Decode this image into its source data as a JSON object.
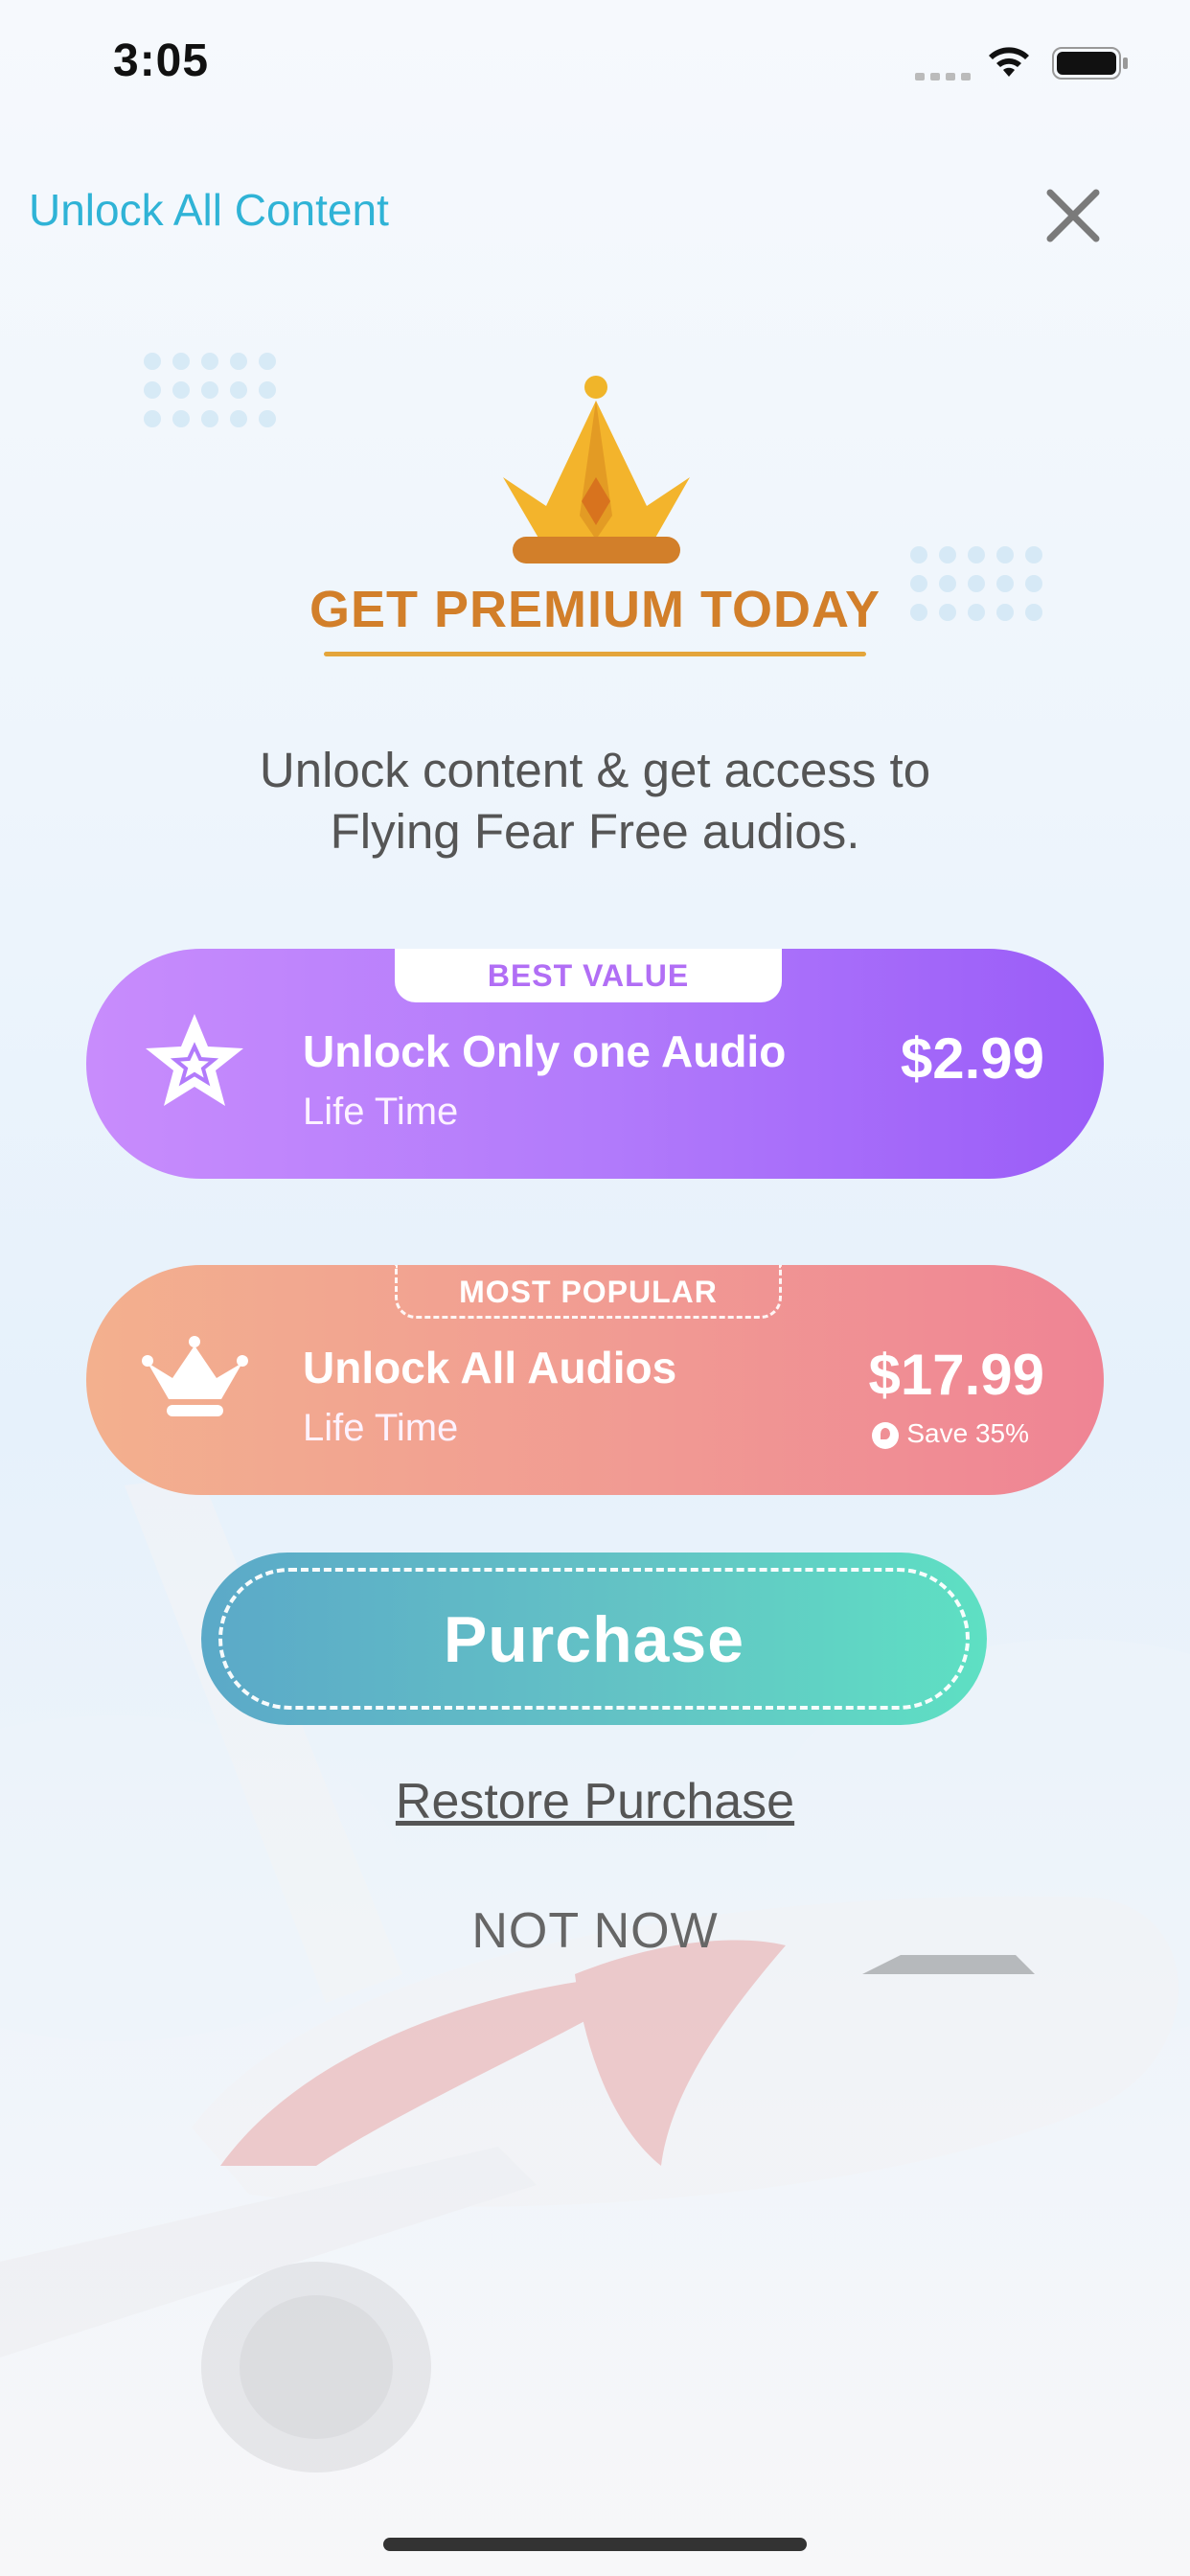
{
  "status_bar": {
    "time": "3:05"
  },
  "header": {
    "title": "Unlock All Content"
  },
  "hero": {
    "title": "GET PREMIUM TODAY",
    "subtitle_line1": "Unlock content & get access to",
    "subtitle_line2": "Flying Fear Free audios."
  },
  "plans": [
    {
      "badge": "BEST VALUE",
      "name": "Unlock Only one Audio",
      "term": "Life Time",
      "price": "$2.99"
    },
    {
      "badge": "MOST POPULAR",
      "name": "Unlock All Audios",
      "term": "Life Time",
      "price": "$17.99",
      "save": "Save 35%"
    }
  ],
  "actions": {
    "purchase": "Purchase",
    "restore": "Restore Purchase",
    "not_now": "NOT NOW"
  },
  "colors": {
    "accent": "#2fb3d6",
    "premium": "#d27f2a",
    "plan1": "#b27bfb",
    "plan2": "#f19a93",
    "purchase": "#63c3c5"
  },
  "icons": {
    "close": "close-icon",
    "crown": "crown-icon",
    "star": "star-icon",
    "wifi": "wifi-icon",
    "battery": "battery-icon"
  }
}
